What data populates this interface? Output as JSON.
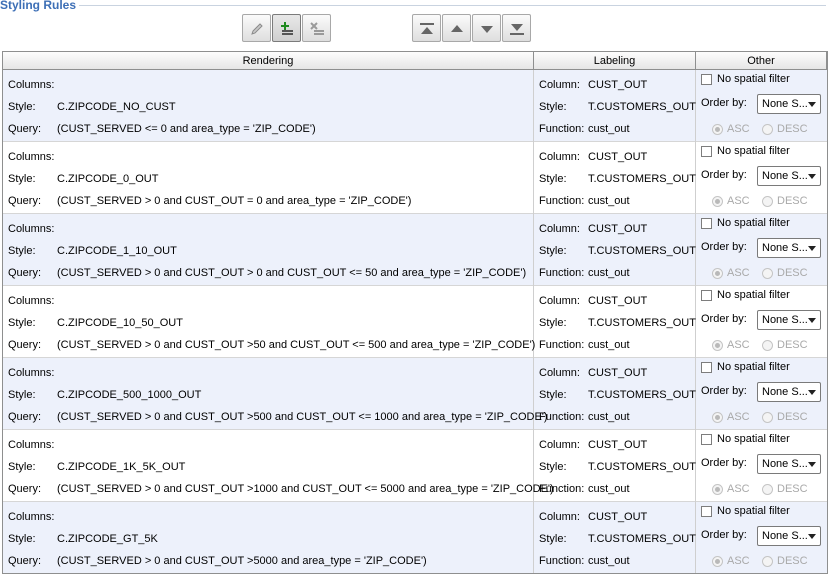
{
  "panel": {
    "title": "Styling Rules"
  },
  "toolbar": {
    "buttons": [
      {
        "icon": "edit-icon"
      },
      {
        "icon": "add-rule-icon"
      },
      {
        "icon": "delete-rule-icon"
      },
      {
        "icon": "move-top-icon"
      },
      {
        "icon": "move-up-icon"
      },
      {
        "icon": "move-down-icon"
      },
      {
        "icon": "move-bottom-icon"
      }
    ]
  },
  "grid": {
    "columns": [
      "Rendering",
      "Labeling",
      "Other"
    ],
    "field_labels": {
      "columns": "Columns:",
      "style": "Style:",
      "query": "Query:",
      "label_column": "Column:",
      "label_style": "Style:",
      "label_function": "Function:",
      "no_spatial_filter": "No spatial filter",
      "order_by": "Order by:",
      "asc": "ASC",
      "desc": "DESC"
    },
    "rows": [
      {
        "columns": "",
        "style": "C.ZIPCODE_NO_CUST",
        "query": "(CUST_SERVED <= 0 and area_type = 'ZIP_CODE')",
        "label_column": "CUST_OUT",
        "label_style": "T.CUSTOMERS_OUT",
        "label_function": "cust_out",
        "no_spatial_filter": false,
        "order_by": "None S...",
        "sort": "ASC"
      },
      {
        "columns": "",
        "style": "C.ZIPCODE_0_OUT",
        "query": "(CUST_SERVED > 0 and  CUST_OUT = 0 and area_type = 'ZIP_CODE')",
        "label_column": "CUST_OUT",
        "label_style": "T.CUSTOMERS_OUT",
        "label_function": "cust_out",
        "no_spatial_filter": false,
        "order_by": "None S...",
        "sort": "ASC"
      },
      {
        "columns": "",
        "style": "C.ZIPCODE_1_10_OUT",
        "query": "(CUST_SERVED > 0 and  CUST_OUT > 0 and  CUST_OUT <= 50 and area_type = 'ZIP_CODE')",
        "label_column": "CUST_OUT",
        "label_style": "T.CUSTOMERS_OUT",
        "label_function": "cust_out",
        "no_spatial_filter": false,
        "order_by": "None S...",
        "sort": "ASC"
      },
      {
        "columns": "",
        "style": "C.ZIPCODE_10_50_OUT",
        "query": "(CUST_SERVED > 0 and  CUST_OUT >50 and  CUST_OUT <= 500 and area_type = 'ZIP_CODE')",
        "label_column": "CUST_OUT",
        "label_style": "T.CUSTOMERS_OUT",
        "label_function": "cust_out",
        "no_spatial_filter": false,
        "order_by": "None S...",
        "sort": "ASC"
      },
      {
        "columns": "",
        "style": "C.ZIPCODE_500_1000_OUT",
        "query": "(CUST_SERVED > 0 and  CUST_OUT >500 and  CUST_OUT <= 1000 and area_type = 'ZIP_CODE')",
        "label_column": "CUST_OUT",
        "label_style": "T.CUSTOMERS_OUT",
        "label_function": "cust_out",
        "no_spatial_filter": false,
        "order_by": "None S...",
        "sort": "ASC"
      },
      {
        "columns": "",
        "style": "C.ZIPCODE_1K_5K_OUT",
        "query": "(CUST_SERVED > 0 and  CUST_OUT >1000 and  CUST_OUT <= 5000 and area_type = 'ZIP_CODE')",
        "label_column": "CUST_OUT",
        "label_style": "T.CUSTOMERS_OUT",
        "label_function": "cust_out",
        "no_spatial_filter": false,
        "order_by": "None S...",
        "sort": "ASC"
      },
      {
        "columns": "",
        "style": "C.ZIPCODE_GT_5K",
        "query": "(CUST_SERVED > 0 and  CUST_OUT >5000 and area_type = 'ZIP_CODE')",
        "label_column": "CUST_OUT",
        "label_style": "T.CUSTOMERS_OUT",
        "label_function": "cust_out",
        "no_spatial_filter": false,
        "order_by": "None S...",
        "sort": "ASC"
      }
    ]
  }
}
